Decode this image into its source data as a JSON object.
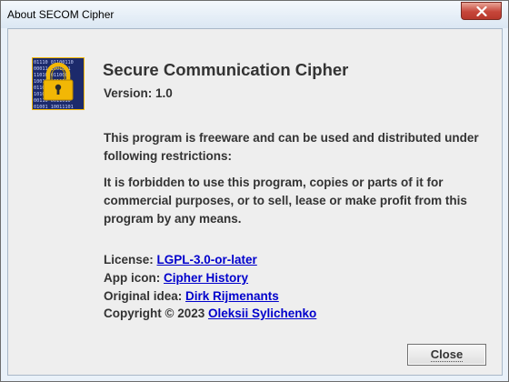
{
  "window": {
    "title": "About SECOM Cipher"
  },
  "about": {
    "app_name": "Secure Communication Cipher",
    "version_text": "Version: 1.0",
    "license_paragraph": "This program is freeware and can be used and distributed under following restrictions:",
    "restriction_paragraph": "It is forbidden to use this program, copies or parts of it for commercial purposes, or to sell, lease or make profit from this program by any means.",
    "license_label": "License: ",
    "license_link": "LGPL-3.0-or-later",
    "app_icon_label": "App icon: ",
    "app_icon_link": "Cipher History",
    "original_idea_label": "Original idea: ",
    "original_idea_link": "Dirk Rijmenants",
    "copyright_label": "Copyright © 2023 ",
    "copyright_link": "Oleksii Sylichenko"
  },
  "buttons": {
    "close_label": "Close"
  },
  "icons": {
    "app_icon": "padlock-binary-icon",
    "window_close": "close-icon"
  },
  "colors": {
    "link": "#0000cc",
    "title_close_button": "#c6463a",
    "icon_background": "#1c2a6b",
    "padlock": "#f2b705"
  }
}
